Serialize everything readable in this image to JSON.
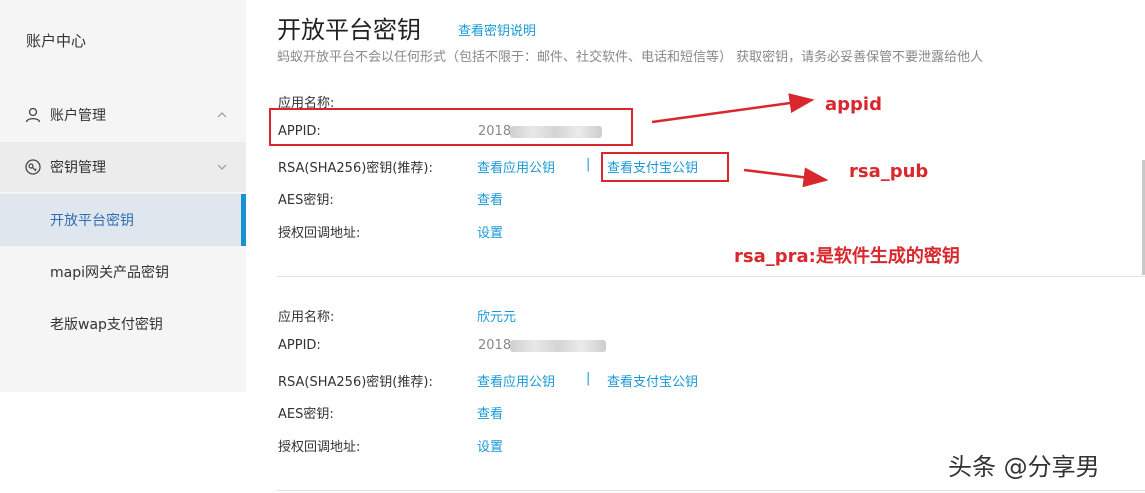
{
  "sidebar": {
    "header": "账户中心",
    "groups": [
      {
        "label": "账户管理",
        "icon": "user-icon"
      },
      {
        "label": "密钥管理",
        "icon": "key-icon"
      }
    ],
    "items": [
      {
        "label": "开放平台密钥",
        "active": true
      },
      {
        "label": "mapi网关产品密钥",
        "active": false
      },
      {
        "label": "老版wap支付密钥",
        "active": false
      }
    ]
  },
  "main": {
    "title": "开放平台密钥",
    "help_link": "查看密钥说明",
    "subtitle": "蚂蚁开放平台不会以任何形式（包括不限于：邮件、社交软件、电话和短信等） 获取密钥，请务必妥善保管不要泄露给他人",
    "apps": [
      {
        "labels": {
          "name": "应用名称:",
          "appid": "APPID:",
          "rsa": "RSA(SHA256)密钥(推荐):",
          "aes": "AES密钥:",
          "callback": "授权回调地址:"
        },
        "name": "",
        "appid": "2018",
        "rsa_app_link": "查看应用公钥",
        "rsa_sep": "|",
        "rsa_alipay_link": "查看支付宝公钥",
        "aes_link": "查看",
        "callback_link": "设置"
      },
      {
        "labels": {
          "name": "应用名称:",
          "appid": "APPID:",
          "rsa": "RSA(SHA256)密钥(推荐):",
          "aes": "AES密钥:",
          "callback": "授权回调地址:"
        },
        "name": "欣元元",
        "appid": "2018",
        "rsa_app_link": "查看应用公钥",
        "rsa_sep": "|",
        "rsa_alipay_link": "查看支付宝公钥",
        "aes_link": "查看",
        "callback_link": "设置"
      }
    ]
  },
  "annotations": {
    "appid": "appid",
    "rsa_pub": "rsa_pub",
    "rsa_pra": "rsa_pra:是软件生成的密钥",
    "color": "#d9272e"
  },
  "watermark": "头条 @分享男",
  "colors": {
    "link": "#1899d6",
    "active_bar": "#1890d6"
  }
}
